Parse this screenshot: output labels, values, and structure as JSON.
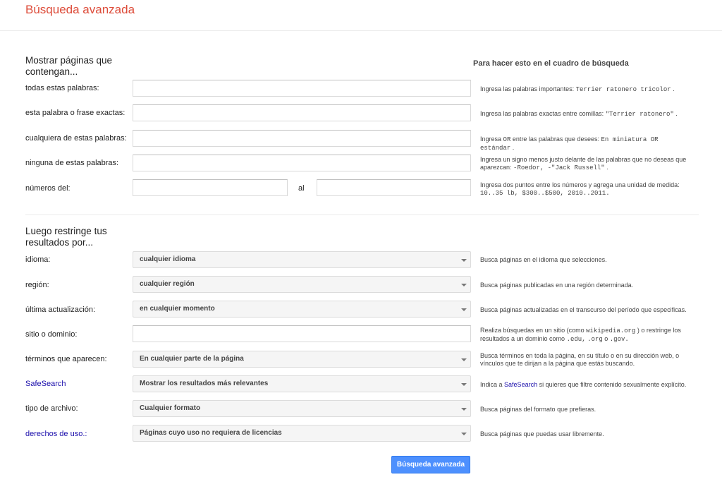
{
  "page_title": "Búsqueda avanzada",
  "section1": {
    "heading": "Mostrar páginas que contengan...",
    "help_heading": "Para hacer esto en el cuadro de búsqueda",
    "rows": [
      {
        "label": "todas estas palabras:",
        "value": "",
        "help_text": "Ingresa las palabras importantes:",
        "help_code": "Terrier ratonero tricolor",
        "help_end": "."
      },
      {
        "label": "esta palabra o frase exactas:",
        "value": "",
        "help_text": "Ingresa las palabras exactas entre comillas:",
        "help_code": "\"Terrier ratonero\"",
        "help_end": "."
      },
      {
        "label": "cualquiera de estas palabras:",
        "value": "",
        "help_pre": "Ingresa",
        "help_or": "OR",
        "help_text": "entre las palabras que desees:",
        "help_code": "En miniatura OR estándar",
        "help_end": "."
      },
      {
        "label": "ninguna de estas palabras:",
        "value": "",
        "help_text": "Ingresa un signo menos justo delante de las palabras que no deseas que aparezcan:",
        "help_code": "-Roedor, -\"Jack Russell\"",
        "help_end": "."
      },
      {
        "label": "números del:",
        "value_from": "",
        "value_to": "",
        "between": "al",
        "help_text": "Ingresa dos puntos entre los números y agrega una unidad de medida:",
        "help_code": "10..35 lb, $300..$500, 2010..2011."
      }
    ]
  },
  "section2": {
    "heading": "Luego restringe tus resultados por...",
    "rows": [
      {
        "label": "idioma:",
        "selected": "cualquier idioma",
        "help": "Busca páginas en el idioma que selecciones."
      },
      {
        "label": "región:",
        "selected": "cualquier región",
        "help": "Busca páginas publicadas en una región determinada."
      },
      {
        "label": "última actualización:",
        "selected": "en cualquier momento",
        "help": "Busca páginas actualizadas en el transcurso del período que especificas."
      },
      {
        "label": "sitio o dominio:",
        "value": "",
        "help_a": "Realiza búsquedas en un sitio (como",
        "help_code1": "wikipedia.org",
        "help_b": ") o restringe los resultados a un dominio como",
        "help_code2": ".edu,",
        "help_code3": ".org",
        "help_c": "o",
        "help_code4": ".gov."
      },
      {
        "label": "términos que aparecen:",
        "selected": "En cualquier parte de la página",
        "help": "Busca términos en toda la página, en su título o en su dirección web, o vínculos que te dirijan a la página que estás buscando."
      },
      {
        "label": "SafeSearch",
        "selected": "Mostrar los resultados más relevantes",
        "help_a": "Indica a",
        "help_link": "SafeSearch",
        "help_b": "si quieres que filtre contenido sexualmente explícito."
      },
      {
        "label": "tipo de archivo:",
        "selected": "Cualquier formato",
        "help": "Busca páginas del formato que prefieras."
      },
      {
        "label": "derechos de uso.:",
        "selected": "Páginas cuyo uso no requiera de licencias",
        "help": "Busca páginas que puedas usar libremente."
      }
    ]
  },
  "submit_label": "Búsqueda avanzada",
  "colors": {
    "title": "#dd4b39",
    "button": "#4d90fe",
    "link": "#1a0dab"
  }
}
